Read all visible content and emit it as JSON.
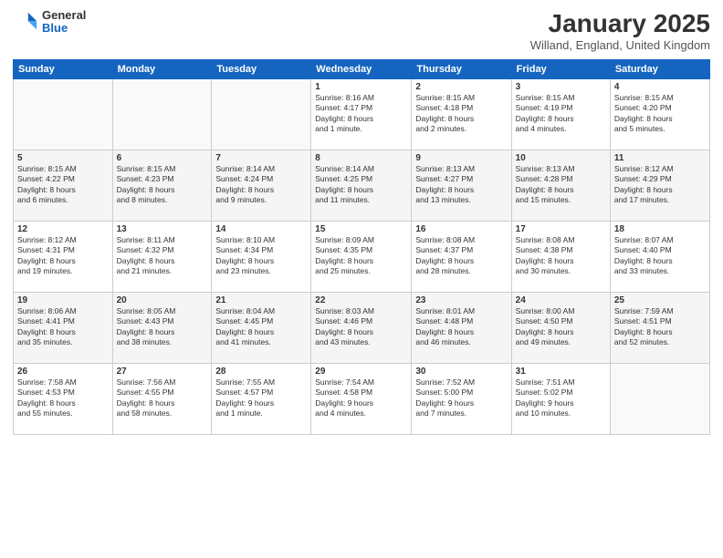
{
  "logo": {
    "general": "General",
    "blue": "Blue"
  },
  "title": "January 2025",
  "subtitle": "Willand, England, United Kingdom",
  "days_of_week": [
    "Sunday",
    "Monday",
    "Tuesday",
    "Wednesday",
    "Thursday",
    "Friday",
    "Saturday"
  ],
  "weeks": [
    [
      {
        "day": "",
        "info": ""
      },
      {
        "day": "",
        "info": ""
      },
      {
        "day": "",
        "info": ""
      },
      {
        "day": "1",
        "info": "Sunrise: 8:16 AM\nSunset: 4:17 PM\nDaylight: 8 hours\nand 1 minute."
      },
      {
        "day": "2",
        "info": "Sunrise: 8:15 AM\nSunset: 4:18 PM\nDaylight: 8 hours\nand 2 minutes."
      },
      {
        "day": "3",
        "info": "Sunrise: 8:15 AM\nSunset: 4:19 PM\nDaylight: 8 hours\nand 4 minutes."
      },
      {
        "day": "4",
        "info": "Sunrise: 8:15 AM\nSunset: 4:20 PM\nDaylight: 8 hours\nand 5 minutes."
      }
    ],
    [
      {
        "day": "5",
        "info": "Sunrise: 8:15 AM\nSunset: 4:22 PM\nDaylight: 8 hours\nand 6 minutes."
      },
      {
        "day": "6",
        "info": "Sunrise: 8:15 AM\nSunset: 4:23 PM\nDaylight: 8 hours\nand 8 minutes."
      },
      {
        "day": "7",
        "info": "Sunrise: 8:14 AM\nSunset: 4:24 PM\nDaylight: 8 hours\nand 9 minutes."
      },
      {
        "day": "8",
        "info": "Sunrise: 8:14 AM\nSunset: 4:25 PM\nDaylight: 8 hours\nand 11 minutes."
      },
      {
        "day": "9",
        "info": "Sunrise: 8:13 AM\nSunset: 4:27 PM\nDaylight: 8 hours\nand 13 minutes."
      },
      {
        "day": "10",
        "info": "Sunrise: 8:13 AM\nSunset: 4:28 PM\nDaylight: 8 hours\nand 15 minutes."
      },
      {
        "day": "11",
        "info": "Sunrise: 8:12 AM\nSunset: 4:29 PM\nDaylight: 8 hours\nand 17 minutes."
      }
    ],
    [
      {
        "day": "12",
        "info": "Sunrise: 8:12 AM\nSunset: 4:31 PM\nDaylight: 8 hours\nand 19 minutes."
      },
      {
        "day": "13",
        "info": "Sunrise: 8:11 AM\nSunset: 4:32 PM\nDaylight: 8 hours\nand 21 minutes."
      },
      {
        "day": "14",
        "info": "Sunrise: 8:10 AM\nSunset: 4:34 PM\nDaylight: 8 hours\nand 23 minutes."
      },
      {
        "day": "15",
        "info": "Sunrise: 8:09 AM\nSunset: 4:35 PM\nDaylight: 8 hours\nand 25 minutes."
      },
      {
        "day": "16",
        "info": "Sunrise: 8:08 AM\nSunset: 4:37 PM\nDaylight: 8 hours\nand 28 minutes."
      },
      {
        "day": "17",
        "info": "Sunrise: 8:08 AM\nSunset: 4:38 PM\nDaylight: 8 hours\nand 30 minutes."
      },
      {
        "day": "18",
        "info": "Sunrise: 8:07 AM\nSunset: 4:40 PM\nDaylight: 8 hours\nand 33 minutes."
      }
    ],
    [
      {
        "day": "19",
        "info": "Sunrise: 8:06 AM\nSunset: 4:41 PM\nDaylight: 8 hours\nand 35 minutes."
      },
      {
        "day": "20",
        "info": "Sunrise: 8:05 AM\nSunset: 4:43 PM\nDaylight: 8 hours\nand 38 minutes."
      },
      {
        "day": "21",
        "info": "Sunrise: 8:04 AM\nSunset: 4:45 PM\nDaylight: 8 hours\nand 41 minutes."
      },
      {
        "day": "22",
        "info": "Sunrise: 8:03 AM\nSunset: 4:46 PM\nDaylight: 8 hours\nand 43 minutes."
      },
      {
        "day": "23",
        "info": "Sunrise: 8:01 AM\nSunset: 4:48 PM\nDaylight: 8 hours\nand 46 minutes."
      },
      {
        "day": "24",
        "info": "Sunrise: 8:00 AM\nSunset: 4:50 PM\nDaylight: 8 hours\nand 49 minutes."
      },
      {
        "day": "25",
        "info": "Sunrise: 7:59 AM\nSunset: 4:51 PM\nDaylight: 8 hours\nand 52 minutes."
      }
    ],
    [
      {
        "day": "26",
        "info": "Sunrise: 7:58 AM\nSunset: 4:53 PM\nDaylight: 8 hours\nand 55 minutes."
      },
      {
        "day": "27",
        "info": "Sunrise: 7:56 AM\nSunset: 4:55 PM\nDaylight: 8 hours\nand 58 minutes."
      },
      {
        "day": "28",
        "info": "Sunrise: 7:55 AM\nSunset: 4:57 PM\nDaylight: 9 hours\nand 1 minute."
      },
      {
        "day": "29",
        "info": "Sunrise: 7:54 AM\nSunset: 4:58 PM\nDaylight: 9 hours\nand 4 minutes."
      },
      {
        "day": "30",
        "info": "Sunrise: 7:52 AM\nSunset: 5:00 PM\nDaylight: 9 hours\nand 7 minutes."
      },
      {
        "day": "31",
        "info": "Sunrise: 7:51 AM\nSunset: 5:02 PM\nDaylight: 9 hours\nand 10 minutes."
      },
      {
        "day": "",
        "info": ""
      }
    ]
  ]
}
